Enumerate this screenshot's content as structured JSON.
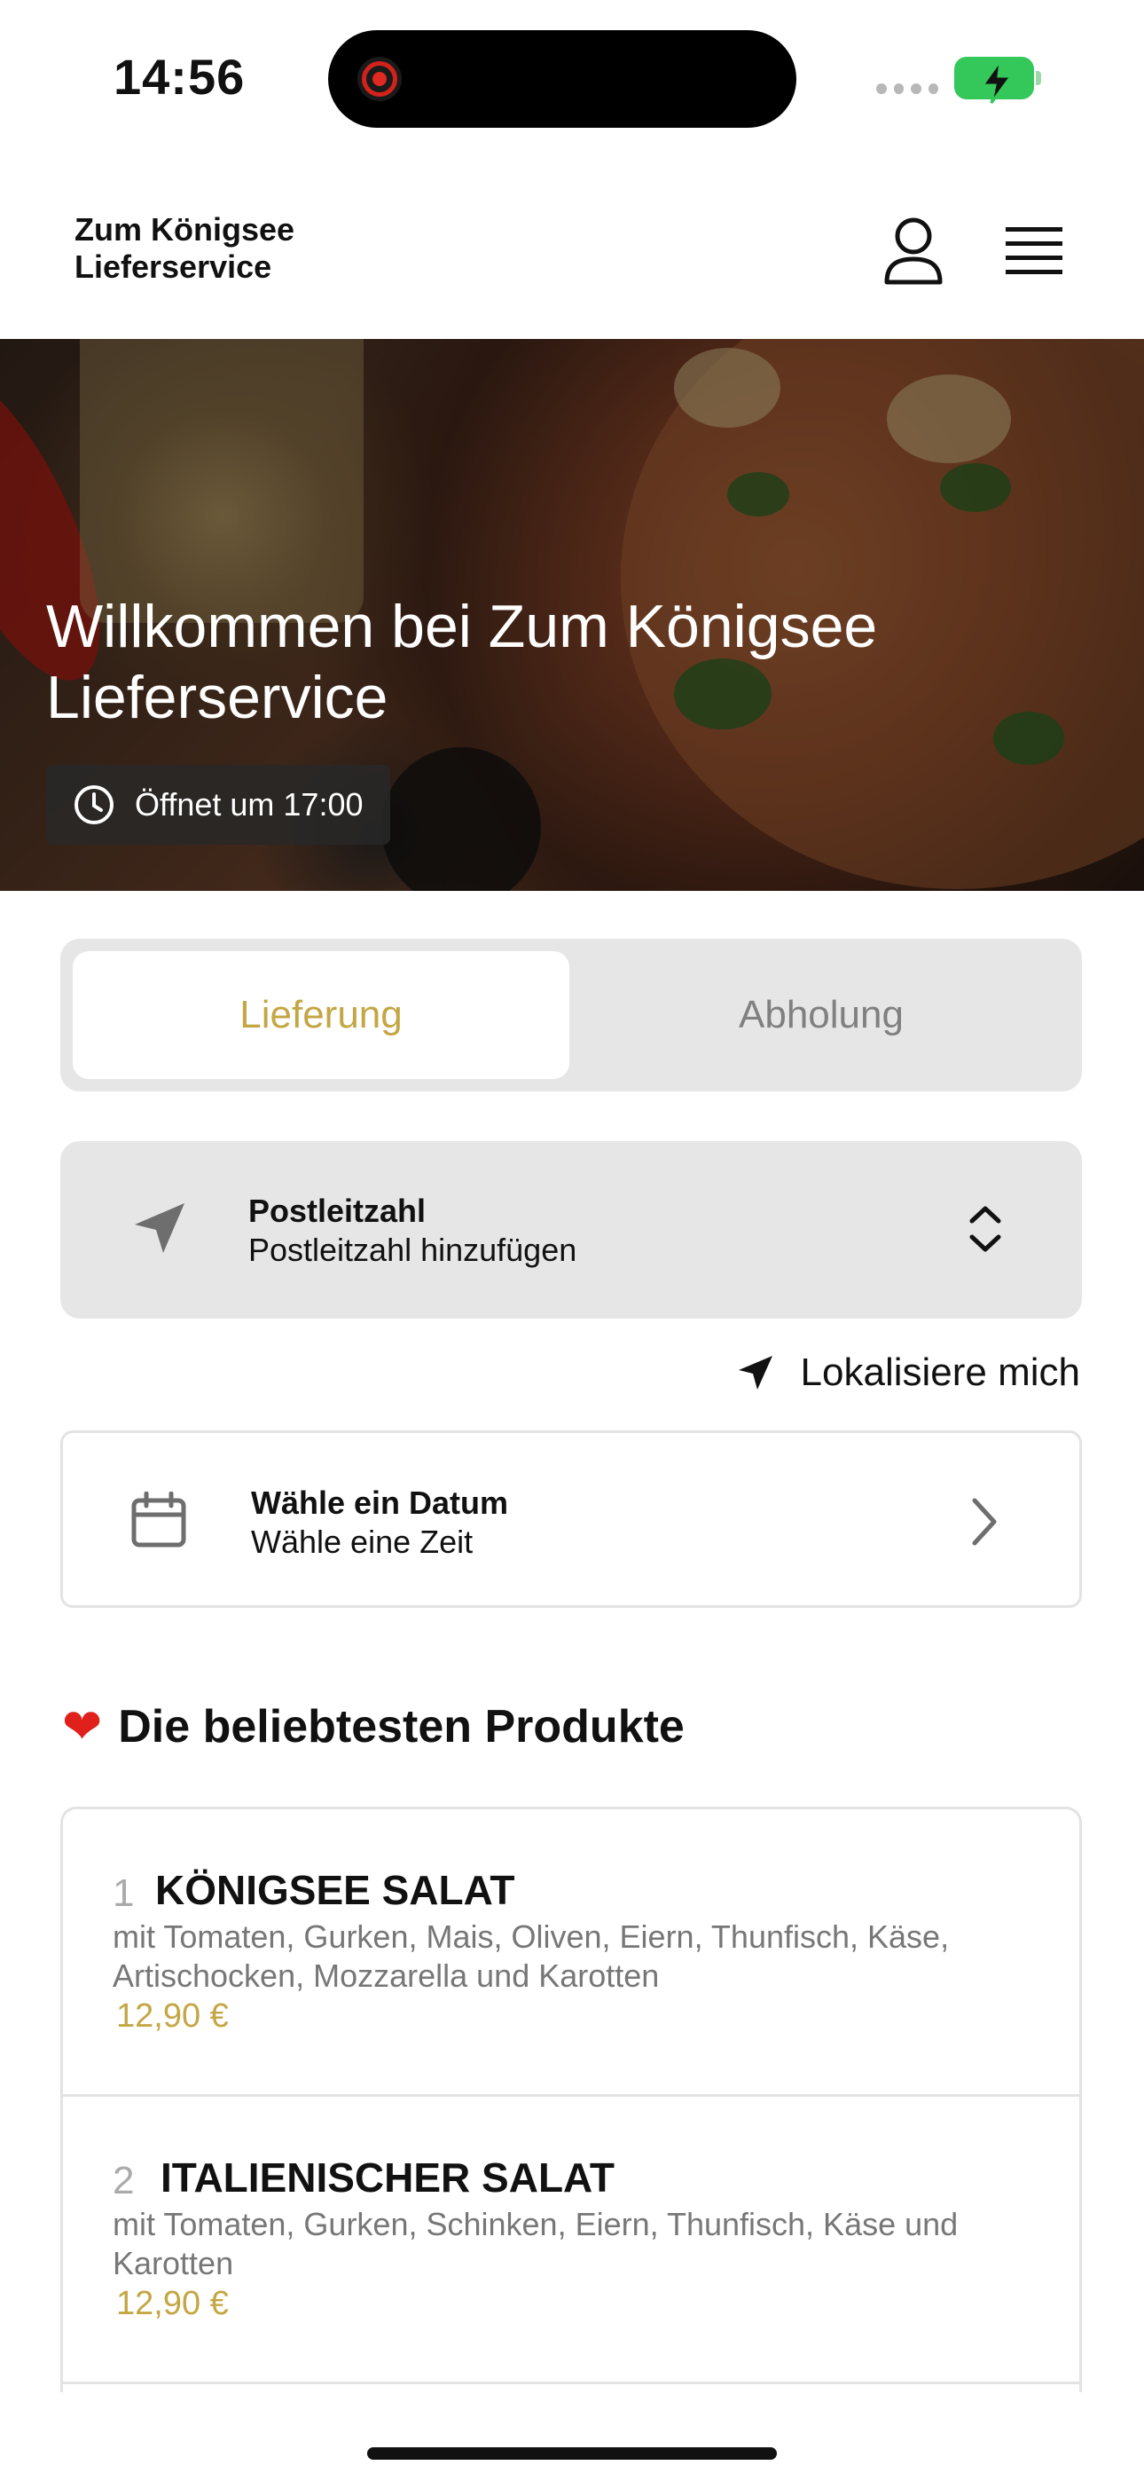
{
  "status_bar": {
    "time": "14:56"
  },
  "header": {
    "brand_line1": "Zum Königsee",
    "brand_line2": "Lieferservice"
  },
  "hero": {
    "title": "Willkommen bei Zum Königsee Lieferservice",
    "opening": "Öffnet um 17:00"
  },
  "mode_toggle": {
    "options": [
      "Lieferung",
      "Abholung"
    ],
    "selected": "Lieferung"
  },
  "postcode": {
    "label": "Postleitzahl",
    "placeholder": "Postleitzahl hinzufügen"
  },
  "locate": {
    "label": "Lokalisiere mich"
  },
  "date_picker": {
    "label": "Wähle ein Datum",
    "sub": "Wähle eine Zeit"
  },
  "popular": {
    "title": "Die beliebtesten Produkte",
    "items": [
      {
        "rank": "1",
        "name": "KÖNIGSEE SALAT",
        "description": "mit Tomaten, Gurken, Mais, Oliven, Eiern, Thunfisch, Käse, Artischocken, Mozzarella und Karotten",
        "price": "12,90 €"
      },
      {
        "rank": "2",
        "name": "ITALIENISCHER SALAT",
        "description": "mit Tomaten, Gurken, Schinken, Eiern, Thunfisch, Käse und Karotten",
        "price": "12,90 €"
      }
    ]
  },
  "colors": {
    "accent": "#c4a645",
    "panel": "#e6e6e6",
    "heart": "#e0201b",
    "battery": "#34c759"
  }
}
